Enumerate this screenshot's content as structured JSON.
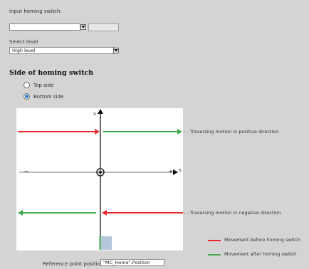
{
  "input_homing_switch": {
    "label": "Input homing switch:",
    "value": "",
    "browse_label": ""
  },
  "select_level": {
    "label": "Select level",
    "value": "High level"
  },
  "side_section": {
    "title": "Side of homing switch",
    "options": [
      {
        "label": "Top side",
        "selected": false
      },
      {
        "label": "Bottom side",
        "selected": true
      }
    ]
  },
  "diagram": {
    "v_axis_label": "v",
    "s_axis_label": "s",
    "minus_label": "−",
    "plus_label": "+",
    "positive_text": "- - Traversing motion in positive direction",
    "negative_text": "- - Traversing motion in negative direction"
  },
  "legend": {
    "before": {
      "label": "Movement before homing switch",
      "color": "#e8262c"
    },
    "after": {
      "label": "Movement after homing switch",
      "color": "#43a84a"
    }
  },
  "reference_point": {
    "label": "Reference point position:",
    "value": "\"MC_Home\".Position"
  },
  "colors": {
    "accent_radio": "#1e78c8",
    "marker_fill": "#b4c8dc"
  }
}
